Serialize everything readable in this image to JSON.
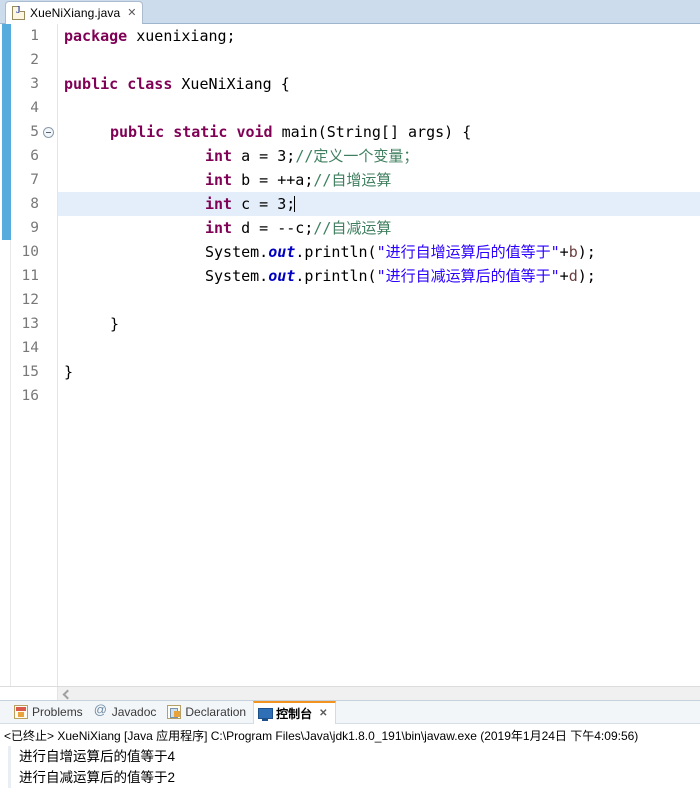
{
  "editor": {
    "tab": {
      "label": "XueNiXiang.java",
      "icon": "java-file-icon",
      "close": "✕"
    },
    "line_numbers": [
      1,
      2,
      3,
      4,
      5,
      6,
      7,
      8,
      9,
      10,
      11,
      12,
      13,
      14,
      15,
      16
    ],
    "fold_marker_line": 5,
    "highlighted_line": 8,
    "change_marker_lines": [
      5,
      13
    ],
    "caret_line": 8,
    "code": {
      "l1_kw": "package",
      "l1_rest": " xuenixiang;",
      "l3_kw1": "public",
      "l3_kw2": "class",
      "l3_name": " XueNiXiang {",
      "l5_kw1": "public",
      "l5_kw2": "static",
      "l5_kw3": "void",
      "l5_rest": " main(String[] args) {",
      "l6_kw": "int",
      "l6_rest": " a = 3;",
      "l6_cmt": "//定义一个变量；",
      "l7_kw": "int",
      "l7_rest": " b = ++a;",
      "l7_cmt": "//自增运算",
      "l8_kw": "int",
      "l8_rest": " c = 3;",
      "l9_kw": "int",
      "l9_rest": " d = --c;",
      "l9_cmt": "//自减运算",
      "l10_pre": "System.",
      "l10_field": "out",
      "l10_mid": ".println(",
      "l10_str": "\"进行自增运算后的值等于\"",
      "l10_plus": "+",
      "l10_var": "b",
      "l10_end": ");",
      "l11_pre": "System.",
      "l11_field": "out",
      "l11_mid": ".println(",
      "l11_str": "\"进行自减运算后的值等于\"",
      "l11_plus": "+",
      "l11_var": "d",
      "l11_end": ");",
      "l13_brace": "}",
      "l15_brace": "}"
    },
    "scrollbar": {
      "left_arrow": "scroll-left-arrow"
    }
  },
  "console": {
    "tabs": [
      {
        "label": "Problems",
        "icon": "problems-icon",
        "active": false
      },
      {
        "label": "Javadoc",
        "icon": "javadoc-icon",
        "active": false
      },
      {
        "label": "Declaration",
        "icon": "declaration-icon",
        "active": false
      },
      {
        "label": "控制台",
        "icon": "console-icon",
        "active": true,
        "close": "✕"
      }
    ],
    "status_line": "<已终止> XueNiXiang [Java 应用程序] C:\\Program Files\\Java\\jdk1.8.0_191\\bin\\javaw.exe (2019年1月24日 下午4:09:56)",
    "output": [
      "进行自增运算后的值等于4",
      "进行自减运算后的值等于2"
    ]
  },
  "colors": {
    "keyword": "#7f0055",
    "comment": "#3f7f5f",
    "string": "#2a00ff",
    "field": "#0000c0",
    "local_var": "#6a3e3e",
    "tabbar_bg": "#ccdcec",
    "highlight_line": "#e4eefb",
    "change_marker": "#1e90d0",
    "active_tab_underline": "#f29422"
  }
}
